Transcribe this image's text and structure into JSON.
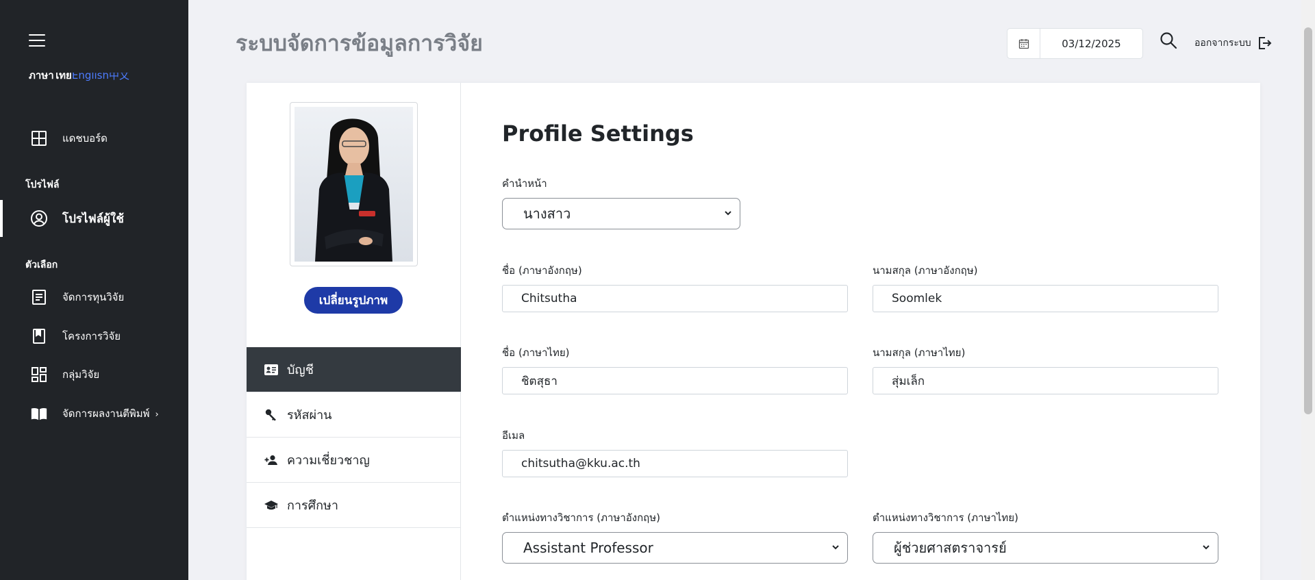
{
  "sidebar": {
    "languages": {
      "thai": "ภาษาไทย",
      "english": "English",
      "chinese": "中文"
    },
    "dashboard": {
      "label": "แดชบอร์ด",
      "icon": "grid-icon"
    },
    "section_profile": "โปรไฟล์",
    "user_profile": {
      "label": "โปรไฟล์ผู้ใช้",
      "icon": "user-circle-icon"
    },
    "section_options": "ตัวเลือก",
    "items": [
      {
        "label": "จัดการทุนวิจัย",
        "icon": "document-icon"
      },
      {
        "label": "โครงการวิจัย",
        "icon": "bookmark-icon"
      },
      {
        "label": "กลุ่มวิจัย",
        "icon": "dashboard-tiles-icon"
      },
      {
        "label": "จัดการผลงานตีพิมพ์",
        "icon": "open-book-icon"
      }
    ]
  },
  "header": {
    "title": "ระบบจัดการข้อมูลการวิจัย",
    "date": "03/12/2025",
    "logout": "ออกจากระบบ"
  },
  "profile": {
    "change_photo": "เปลี่ยนรูปภาพ",
    "tabs": [
      {
        "label": "บัญชี",
        "icon": "id-card-icon"
      },
      {
        "label": "รหัสผ่าน",
        "icon": "key-icon"
      },
      {
        "label": "ความเชี่ยวชาญ",
        "icon": "user-plus-icon"
      },
      {
        "label": "การศึกษา",
        "icon": "graduation-cap-icon"
      }
    ]
  },
  "form": {
    "title": "Profile Settings",
    "prefix": {
      "label": "คำนำหน้า",
      "value": "นางสาว"
    },
    "first_name_en": {
      "label": "ชื่อ (ภาษาอังกฤษ)",
      "value": "Chitsutha"
    },
    "last_name_en": {
      "label": "นามสกุล (ภาษาอังกฤษ)",
      "value": "Soomlek"
    },
    "first_name_th": {
      "label": "ชื่อ (ภาษาไทย)",
      "value": "ชิตสุธา"
    },
    "last_name_th": {
      "label": "นามสกุล (ภาษาไทย)",
      "value": "สุ่มเล็ก"
    },
    "email": {
      "label": "อีเมล",
      "value": "chitsutha@kku.ac.th"
    },
    "position_en": {
      "label": "ตำแหน่งทางวิชาการ (ภาษาอังกฤษ)",
      "value": "Assistant Professor"
    },
    "position_th": {
      "label": "ตำแหน่งทางวิชาการ (ภาษาไทย)",
      "value": "ผู้ช่วยศาสตราจารย์"
    }
  },
  "colors": {
    "sidebar_bg": "#212428",
    "accent": "#1e3aa7",
    "active_tab": "#343a40",
    "page_bg": "#f0f1f5"
  }
}
